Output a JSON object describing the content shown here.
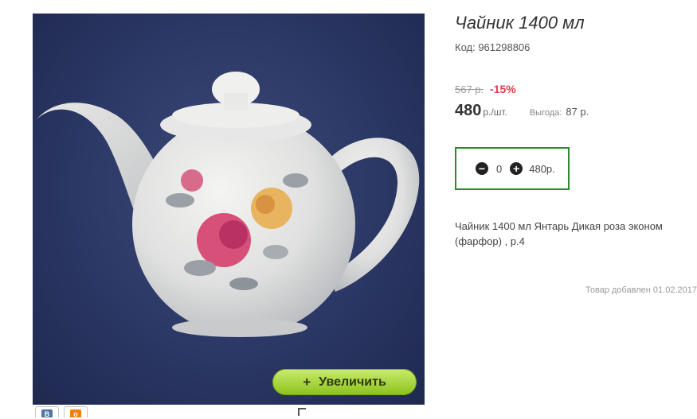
{
  "product": {
    "title": "Чайник 1400 мл",
    "code": "Код: 961298806",
    "old_price": "567 р.",
    "discount": "-15%",
    "price": "480",
    "unit": "р./шт.",
    "saving_label": "Выгода:",
    "saving_value": "87 р.",
    "quantity": "0",
    "total": "480р.",
    "description": "Чайник 1400 мл Янтарь Дикая роза эконом (фарфор) , р.4",
    "added": "Товар добавлен 01.02.2017"
  },
  "gallery": {
    "zoom_label": "Увеличить",
    "zoom_icon": "+"
  },
  "share": {
    "vk_icon": "В",
    "ok_icon": "о"
  },
  "icons": {
    "minus": "minus-circle-icon",
    "plus": "plus-circle-icon"
  },
  "colors": {
    "accent_green": "#2d8a2d",
    "discount_red": "#e53950",
    "zoom_button": "#a6d83c"
  }
}
